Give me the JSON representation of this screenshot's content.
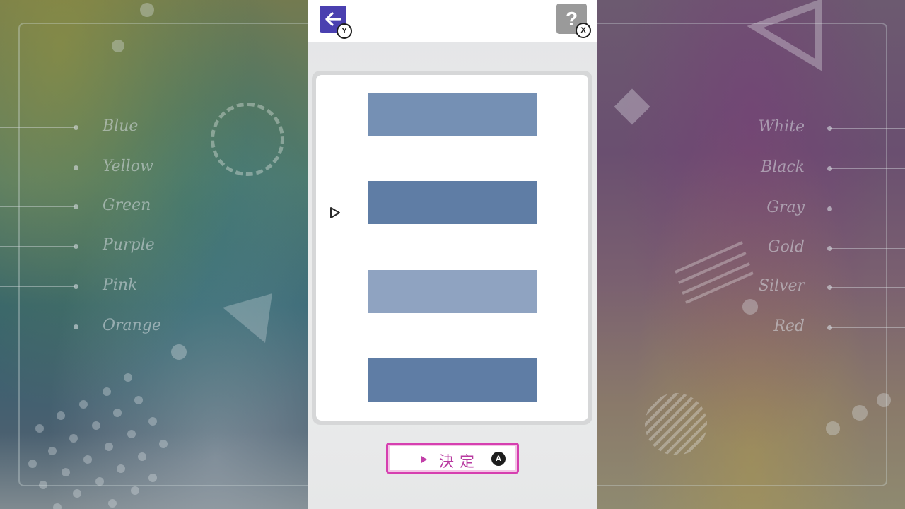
{
  "header": {
    "back_hint": "Y",
    "help_label": "?",
    "help_hint": "X"
  },
  "left_labels": [
    "Blue",
    "Yellow",
    "Green",
    "Purple",
    "Pink",
    "Orange"
  ],
  "right_labels": [
    "White",
    "Black",
    "Gray",
    "Gold",
    "Silver",
    "Red"
  ],
  "swatches": [
    {
      "color": "#7590b4"
    },
    {
      "color": "#5f7da5"
    },
    {
      "color": "#8fa3c1"
    },
    {
      "color": "#5f7da5"
    }
  ],
  "selected_index": 1,
  "confirm": {
    "label": "決定",
    "hint": "A",
    "accent": "#d63fb0"
  },
  "colors": {
    "back_button": "#4a40b0",
    "help_button": "#9a9a9a"
  }
}
